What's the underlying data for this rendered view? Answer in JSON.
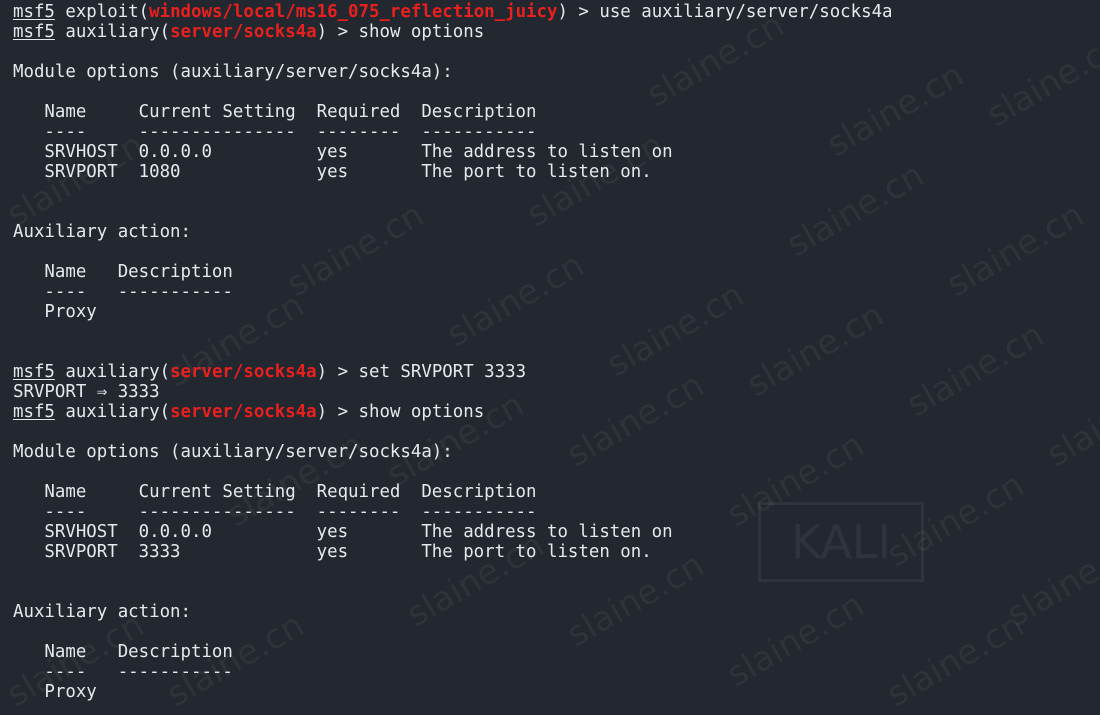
{
  "terminal": {
    "colors": {
      "background": "#23272f",
      "text": "#e6e8ec",
      "module": "#e8201e"
    },
    "lines": [
      [
        {
          "t": "msf5",
          "c": "prompt"
        },
        {
          "t": " exploit("
        },
        {
          "t": "windows/local/ms16_075_reflection_juicy",
          "c": "mod"
        },
        {
          "t": ") > use auxiliary/server/socks4a"
        }
      ],
      [
        {
          "t": "msf5",
          "c": "prompt"
        },
        {
          "t": " auxiliary("
        },
        {
          "t": "server/socks4a",
          "c": "mod"
        },
        {
          "t": ") > show options"
        }
      ],
      [],
      [
        {
          "t": "Module options (auxiliary/server/socks4a):"
        }
      ],
      [],
      [
        {
          "t": "   Name     Current Setting  Required  Description"
        }
      ],
      [
        {
          "t": "   ----     ---------------  --------  -----------"
        }
      ],
      [
        {
          "t": "   SRVHOST  0.0.0.0          yes       The address to listen on"
        }
      ],
      [
        {
          "t": "   SRVPORT  1080             yes       The port to listen on."
        }
      ],
      [],
      [],
      [
        {
          "t": "Auxiliary action:"
        }
      ],
      [],
      [
        {
          "t": "   Name   Description"
        }
      ],
      [
        {
          "t": "   ----   -----------"
        }
      ],
      [
        {
          "t": "   Proxy"
        }
      ],
      [],
      [],
      [
        {
          "t": "msf5",
          "c": "prompt"
        },
        {
          "t": " auxiliary("
        },
        {
          "t": "server/socks4a",
          "c": "mod"
        },
        {
          "t": ") > set SRVPORT 3333"
        }
      ],
      [
        {
          "t": "SRVPORT ⇒ 3333"
        }
      ],
      [
        {
          "t": "msf5",
          "c": "prompt"
        },
        {
          "t": " auxiliary("
        },
        {
          "t": "server/socks4a",
          "c": "mod"
        },
        {
          "t": ") > show options"
        }
      ],
      [],
      [
        {
          "t": "Module options (auxiliary/server/socks4a):"
        }
      ],
      [],
      [
        {
          "t": "   Name     Current Setting  Required  Description"
        }
      ],
      [
        {
          "t": "   ----     ---------------  --------  -----------"
        }
      ],
      [
        {
          "t": "   SRVHOST  0.0.0.0          yes       The address to listen on"
        }
      ],
      [
        {
          "t": "   SRVPORT  3333             yes       The port to listen on."
        }
      ],
      [],
      [],
      [
        {
          "t": "Auxiliary action:"
        }
      ],
      [],
      [
        {
          "t": "   Name   Description"
        }
      ],
      [
        {
          "t": "   ----   -----------"
        }
      ],
      [
        {
          "t": "   Proxy"
        }
      ]
    ]
  },
  "watermark": {
    "text": "slaine.cn",
    "logo": "KALI"
  }
}
